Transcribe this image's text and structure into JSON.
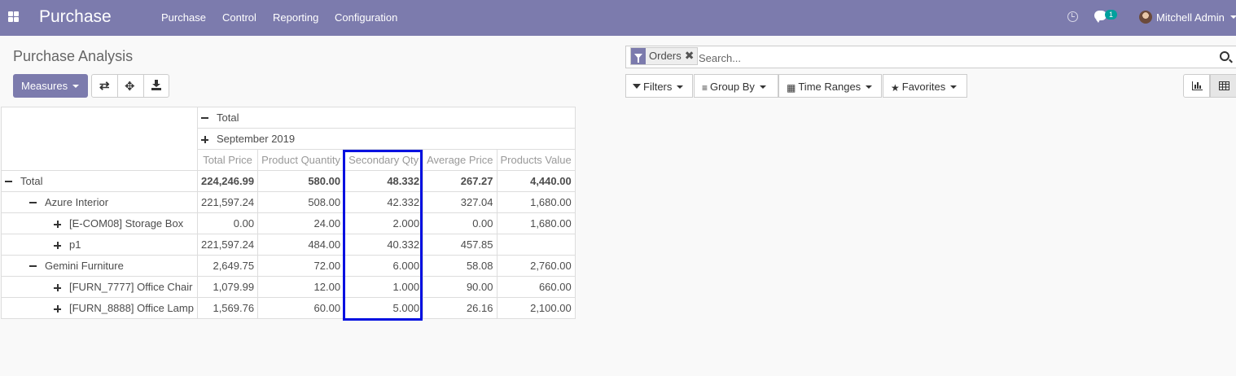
{
  "navbar": {
    "brand": "Purchase",
    "menus": [
      "Purchase",
      "Control",
      "Reporting",
      "Configuration"
    ],
    "chat_count": "1",
    "user_name": "Mitchell Admin",
    "color": "#7c7bad"
  },
  "control_panel": {
    "title": "Purchase Analysis",
    "measures_label": "Measures",
    "search": {
      "facet_label": "Orders",
      "placeholder": "Search..."
    },
    "filters_label": "Filters",
    "groupby_label": "Group By",
    "timeranges_label": "Time Ranges",
    "favorites_label": "Favorites"
  },
  "pivot": {
    "col_total": "Total",
    "col_group": "September 2019",
    "measures": [
      "Total Price",
      "Product Quantity",
      "Secondary Qty",
      "Average Price",
      "Products Value"
    ],
    "rows": [
      {
        "label": "Total",
        "level": 0,
        "toggle": "minus",
        "bold": true,
        "values": [
          "224,246.99",
          "580.00",
          "48.332",
          "267.27",
          "4,440.00"
        ]
      },
      {
        "label": "Azure Interior",
        "level": 1,
        "toggle": "minus",
        "bold": false,
        "values": [
          "221,597.24",
          "508.00",
          "42.332",
          "327.04",
          "1,680.00"
        ]
      },
      {
        "label": "[E-COM08] Storage Box",
        "level": 2,
        "toggle": "plus",
        "bold": false,
        "values": [
          "0.00",
          "24.00",
          "2.000",
          "0.00",
          "1,680.00"
        ]
      },
      {
        "label": "p1",
        "level": 2,
        "toggle": "plus",
        "bold": false,
        "values": [
          "221,597.24",
          "484.00",
          "40.332",
          "457.85",
          ""
        ]
      },
      {
        "label": "Gemini Furniture",
        "level": 1,
        "toggle": "minus",
        "bold": false,
        "values": [
          "2,649.75",
          "72.00",
          "6.000",
          "58.08",
          "2,760.00"
        ]
      },
      {
        "label": "[FURN_7777] Office Chair",
        "level": 2,
        "toggle": "plus",
        "bold": false,
        "values": [
          "1,079.99",
          "12.00",
          "1.000",
          "90.00",
          "660.00"
        ]
      },
      {
        "label": "[FURN_8888] Office Lamp",
        "level": 2,
        "toggle": "plus",
        "bold": false,
        "values": [
          "1,569.76",
          "60.00",
          "5.000",
          "26.16",
          "2,100.00"
        ]
      }
    ]
  },
  "highlight_color": "#0010e0"
}
